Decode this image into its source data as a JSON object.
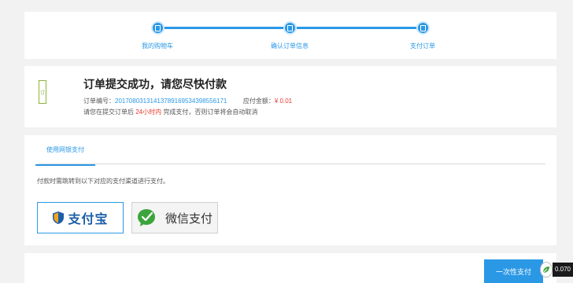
{
  "steps": [
    {
      "label": "我的购物车"
    },
    {
      "label": "确认订单信息"
    },
    {
      "label": "支付订单"
    }
  ],
  "order": {
    "icon_text": "订",
    "title": "订单提交成功，请您尽快付款",
    "number_label": "订单编号：",
    "number_value": "20170803131413789169534398556171",
    "amount_label": "应付金额：",
    "amount_value": "¥ 0.01",
    "notice_prefix": "请您在提交订单后 ",
    "notice_highlight": "24小时内",
    "notice_suffix": " 完成支付，否则订单将会自动取消"
  },
  "payment": {
    "tab_label": "使用网银支付",
    "note": "付款时需跳转到以下对应的支付渠道进行支付。",
    "methods": [
      {
        "label": "支付宝",
        "icon": "alipay-shield-icon"
      },
      {
        "label": "微信支付",
        "icon": "wechat-icon"
      }
    ]
  },
  "footer": {
    "pay_button": "一次性支付"
  },
  "float": {
    "value": "0.070"
  },
  "colors": {
    "accent": "#2b98e6",
    "price": "#e53a2c",
    "background": "#f2f2f2"
  }
}
